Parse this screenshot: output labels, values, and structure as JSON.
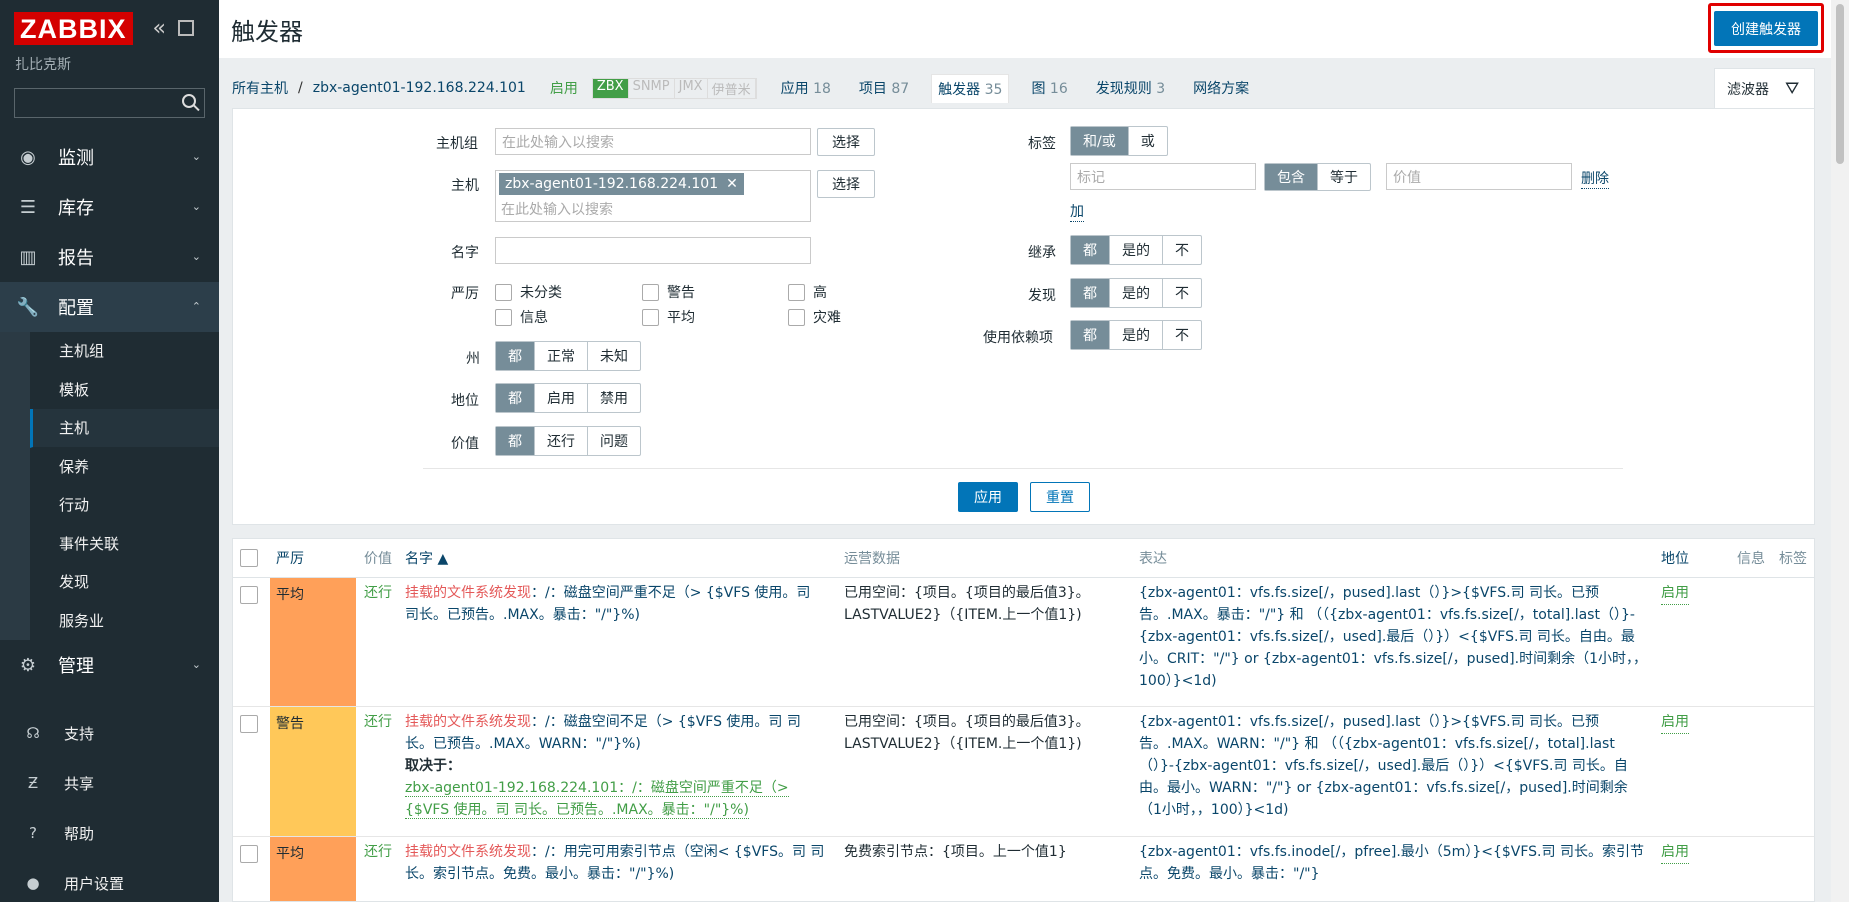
{
  "sidebar": {
    "logo": "ZABBIX",
    "subtitle": "扎比克斯",
    "search_placeholder": "",
    "menu": [
      {
        "label": "监测",
        "icon": "eye-icon"
      },
      {
        "label": "库存",
        "icon": "list-icon"
      },
      {
        "label": "报告",
        "icon": "chart-icon"
      },
      {
        "label": "配置",
        "icon": "wrench-icon"
      }
    ],
    "submenu": [
      "主机组",
      "模板",
      "主机",
      "保养",
      "行动",
      "事件关联",
      "发现",
      "服务业"
    ],
    "admin": {
      "label": "管理",
      "icon": "gear-icon"
    },
    "bottom": [
      {
        "label": "支持",
        "icon": "headset-icon"
      },
      {
        "label": "共享",
        "icon": "share-icon"
      },
      {
        "label": "帮助",
        "icon": "help-icon"
      },
      {
        "label": "用户设置",
        "icon": "user-icon"
      }
    ]
  },
  "header": {
    "title": "触发器",
    "create_button": "创建触发器"
  },
  "breadcrumb": {
    "all_hosts": "所有主机",
    "separator": "/",
    "host": "zbx-agent01-192.168.224.101",
    "status": "启用",
    "availability": [
      "ZBX",
      "SNMP",
      "JMX",
      "伊普米"
    ],
    "tabs": [
      {
        "label": "应用",
        "count": "18"
      },
      {
        "label": "项目",
        "count": "87"
      },
      {
        "label": "触发器",
        "count": "35"
      },
      {
        "label": "图",
        "count": "16"
      },
      {
        "label": "发现规则",
        "count": "3"
      },
      {
        "label": "网络方案",
        "count": ""
      }
    ],
    "filter_tab": "滤波器"
  },
  "filter": {
    "host_group_label": "主机组",
    "host_group_placeholder": "在此处输入以搜索",
    "select": "选择",
    "host_label": "主机",
    "host_value": "zbx-agent01-192.168.224.101",
    "host_placeholder": "在此处输入以搜索",
    "name_label": "名字",
    "severity_label": "严厉",
    "severities": [
      "未分类",
      "警告",
      "高",
      "信息",
      "平均",
      "灾难"
    ],
    "state_label": "州",
    "state_options": [
      "都",
      "正常",
      "未知"
    ],
    "status_label": "地位",
    "status_options": [
      "都",
      "启用",
      "禁用"
    ],
    "value_label": "价值",
    "value_options": [
      "都",
      "还行",
      "问题"
    ],
    "tags_label": "标签",
    "tags_options": [
      "和/或",
      "或"
    ],
    "tag_placeholder": "标记",
    "tag_ops": [
      "包含",
      "等于"
    ],
    "tag_value_placeholder": "价值",
    "remove": "删除",
    "add": "加",
    "inherited_label": "继承",
    "discovered_label": "发现",
    "depends_label": "使用依赖项",
    "yesno_options": [
      "都",
      "是的",
      "不"
    ],
    "apply": "应用",
    "reset": "重置"
  },
  "table": {
    "headers": [
      "严厉",
      "价值",
      "名字 ▲",
      "运营数据",
      "表达",
      "地位",
      "信息",
      "标签"
    ],
    "rows": [
      {
        "severity": "平均",
        "value": "还行",
        "name_prefix": "挂载的文件系统发现",
        "name_rest": "：/：磁盘空间严重不足（> {$VFS 使用。司 司长。已预告。.MAX。暴击：\"/\"}%)",
        "opdata": "已用空间：{项目。{项目的最后值3}。LASTVALUE2}（{ITEM.上一个值1})",
        "expr": "{zbx-agent01：vfs.fs.size[/，pused].last（）}>{$VFS.司 司长。已预告。.MAX。暴击：\"/\"} 和 （（{zbx-agent01：vfs.fs.size[/，total].last（）}-{zbx-agent01：vfs.fs.size[/，used].最后（）}）<{$VFS.司 司长。自由。最小。CRIT：\"/\"} or {zbx-agent01：vfs.fs.size[/，pused].时间剩余（1小时，，100）}<1d)",
        "status": "启用"
      },
      {
        "severity": "警告",
        "value": "还行",
        "name_prefix": "挂载的文件系统发现",
        "name_rest": "：/：磁盘空间不足（> {$VFS 使用。司 司长。已预告。.MAX。WARN：\"/\"}%)",
        "depends_label": "取决于：",
        "depends_text": "zbx-agent01-192.168.224.101：/：磁盘空间严重不足（> {$VFS 使用。司 司长。已预告。.MAX。暴击：\"/\"}%)",
        "opdata": "已用空间：{项目。{项目的最后值3}。LASTVALUE2}（{ITEM.上一个值1})",
        "expr": "{zbx-agent01：vfs.fs.size[/，pused].last（）}>{$VFS.司 司长。已预告。.MAX。WARN：\"/\"} 和 （（{zbx-agent01：vfs.fs.size[/，total].last（）}-{zbx-agent01：vfs.fs.size[/，used].最后（）}）<{$VFS.司 司长。自由。最小。WARN：\"/\"} or {zbx-agent01：vfs.fs.size[/，pused].时间剩余（1小时，，100）}<1d)",
        "status": "启用"
      },
      {
        "severity": "平均",
        "value": "还行",
        "name_prefix": "挂载的文件系统发现",
        "name_rest": "：/：用完可用索引节点（空闲< {$VFS。司 司长。索引节点。免费。最小。暴击：\"/\"}%)",
        "opdata": "免费索引节点：{项目。上一个值1}",
        "expr": "{zbx-agent01：vfs.fs.inode[/，pfree].最小（5m）}<{$VFS.司 司长。索引节点。免费。最小。暴击：\"/\"}",
        "status": "启用"
      }
    ]
  }
}
